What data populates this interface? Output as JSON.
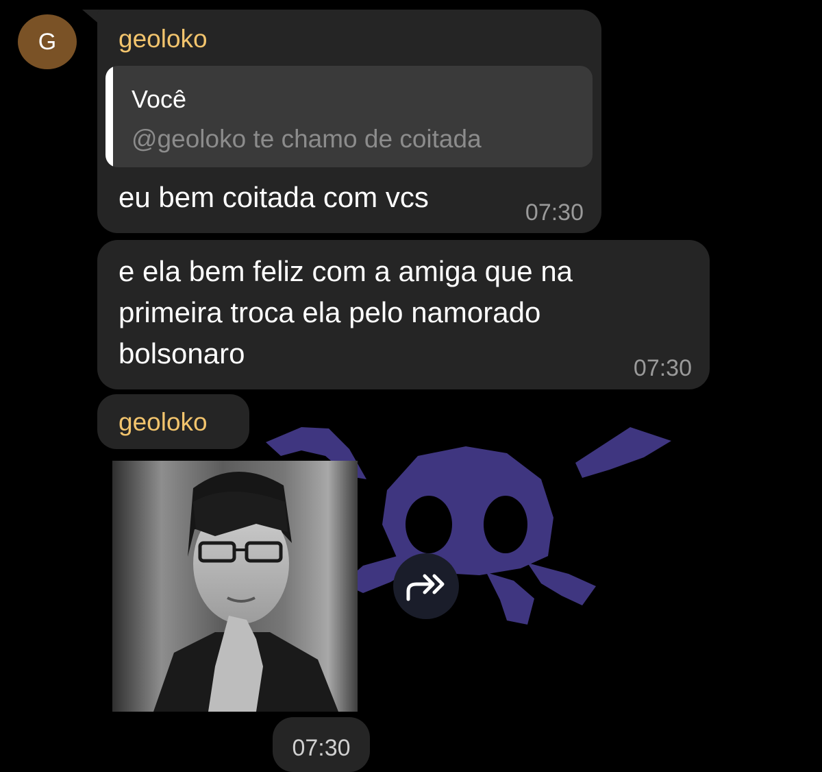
{
  "avatar": {
    "initial": "G",
    "color": "#7a5226"
  },
  "messages": [
    {
      "sender": "geoloko",
      "reply": {
        "author": "Você",
        "text": "@geoloko te chamo de coitada"
      },
      "text": "eu bem coitada com vcs",
      "time": "07:30"
    },
    {
      "lines": [
        "e ela bem feliz com a amiga que na",
        "primeira troca ela pelo namorado",
        "bolsonaro"
      ],
      "time": "07:30"
    },
    {
      "sender": "geoloko",
      "media": {
        "photo_icon": "portrait-photo",
        "sticker_icon": "purple-skull-sticker"
      },
      "forward_icon": "forward-arrow-icon",
      "time": "07:30"
    }
  ],
  "colors": {
    "background": "#000000",
    "bubble": "#252525",
    "sender_name": "#f2c46d",
    "quote_bg": "#3a3a3a",
    "timestamp": "#9a9a9a",
    "sticker": "#3f3680"
  }
}
